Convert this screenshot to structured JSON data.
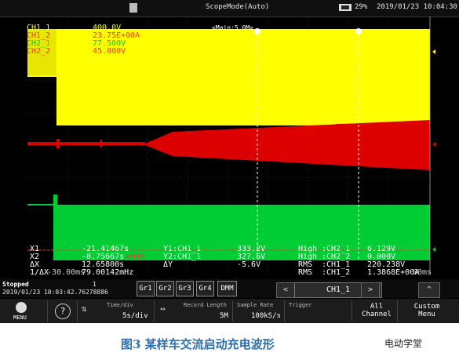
{
  "topbar": {
    "title": "ScopeMode(Auto)",
    "rate": "29%",
    "datetime": "2019/01/23 10:04:30"
  },
  "main_label": "<Main:5.0M>",
  "channels": [
    {
      "name": "CH1_1",
      "value": "400.0V",
      "color": "#ffff00"
    },
    {
      "name": "CH1_2",
      "value": "23.75E+00A",
      "color": "#ff0000"
    },
    {
      "name": "CH2_1",
      "value": "77.500V",
      "color": "#00ff00"
    },
    {
      "name": "CH2_2",
      "value": "45.000V",
      "color": "#ff4444"
    }
  ],
  "readouts": {
    "x1": "X1",
    "x1_val": "-21.41467s",
    "x2": "X2",
    "x2_val": "-8.75667s",
    "dx": "ΔX",
    "dx_val": "12.65800s",
    "inv": "1/ΔX",
    "inv_val": "79.00142mHz",
    "y1": "Y1:CH1_1",
    "y1_val": "333.2V",
    "y2": "Y2:CH1_1",
    "y2_val": "327.6V",
    "dy": "ΔY",
    "dy_val": "-5.6V",
    "high1": "High",
    "high1_ch": ":CH2_1",
    "high1_val": "6.129V",
    "high2": "High",
    "high2_ch": ":CH2_2",
    "high2_val": "0.000V",
    "rms1": "RMS",
    "rms1_ch": ":CH1_1",
    "rms1_val": "220.238V",
    "rms2": "RMS",
    "rms2_ch": ":CH1_2",
    "rms2_val": "1.3868E+00A",
    "left_time": "-30.00ms",
    "right_time": "00ms",
    "overlay_a": "+00A"
  },
  "status": {
    "state": "Stopped",
    "count": "1",
    "timestamp": "2019/01/23 10:03:42.76278886",
    "groups": [
      "Gr1",
      "Gr2",
      "Gr3",
      "Gr4",
      "DMM"
    ],
    "channel_select": "CH1_1",
    "prev": "<",
    "next": ">",
    "up": "^"
  },
  "buttons": {
    "menu": "MENU",
    "help": "?",
    "time_div_label": "Time/div",
    "time_div_value": "5s/div",
    "record_label": "Record Length",
    "record_value": "5M",
    "sample_label": "Sample Rate",
    "sample_value": "100kS/s",
    "trigger_label": "Trigger",
    "all_channel": "All Channel",
    "custom_menu": "Custom Menu"
  },
  "caption": {
    "figure": "图3  某样车交流启动充电波形",
    "source": "电动学堂"
  }
}
